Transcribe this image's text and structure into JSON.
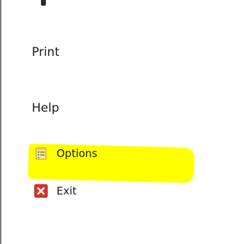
{
  "menu": {
    "items": [
      {
        "label": "Print"
      },
      {
        "label": "Help"
      }
    ],
    "sub_items": [
      {
        "label": "Options",
        "icon": "options-icon"
      },
      {
        "label": "Exit",
        "icon": "exit-icon"
      }
    ]
  },
  "colors": {
    "highlight": "#ffff00",
    "exit_icon": "#d9332a",
    "options_icon": "#e8c84a"
  }
}
